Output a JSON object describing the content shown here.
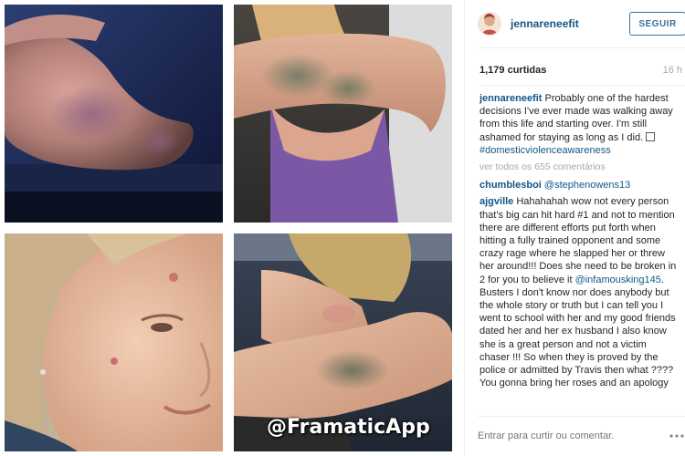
{
  "post": {
    "username": "jennareneefit",
    "follow_label": "SEGUIR",
    "likes": "1,179 curtidas",
    "age": "16 h",
    "watermark": "@FramaticApp"
  },
  "caption": {
    "author": "jennareneefit",
    "text_before": "Probably one of the hardest decisions I've ever made was walking away from this life and starting over. I'm still ashamed for staying as long as I did. ",
    "hashtag": "#domesticviolenceawareness"
  },
  "view_all": "ver todos os 655 comentários",
  "comments": [
    {
      "author": "chumblesboi",
      "mention": "@stephenowens13",
      "text_before": "",
      "text_after": ""
    },
    {
      "author": "ajgville",
      "mention": "@infamousking145",
      "text_before": "Hahahahah wow not every person that's big can hit hard #1 and not to mention there are different efforts put forth when hitting a fully trained opponent and some crazy rage where he slapped her or threw her around!!! Does she need to be broken in 2 for you to believe it ",
      "text_after": ". Busters I don't know nor does anybody but the whole story or truth but I can tell you I went to school with her and my good friends dated her and her ex husband I also know she is a great person and not a victim chaser !!! So when they is proved by the police or admitted by Travis then what ???? You gonna bring her roses and an apology"
    }
  ],
  "footer": {
    "input_placeholder": "Entrar para curtir ou comentar.",
    "more_icon": "more-horizontal-icon"
  },
  "colors": {
    "link": "#125688",
    "follow_border": "#3f729b",
    "muted": "#a5a7aa"
  }
}
